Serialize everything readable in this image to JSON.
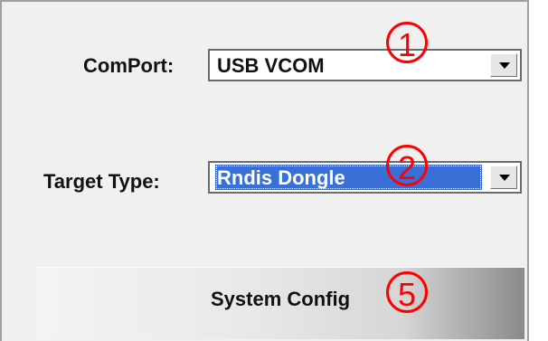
{
  "comport": {
    "label": "ComPort:",
    "value": "USB VCOM"
  },
  "target_type": {
    "label": "Target Type:",
    "value": "Rndis Dongle"
  },
  "system_config": {
    "label": "System Config"
  },
  "annotations": [
    "1",
    "2",
    "5"
  ],
  "colors": {
    "selection": "#3a6fd8",
    "annotation": "#ff0000",
    "panel_bg": "#f0f0f0"
  }
}
